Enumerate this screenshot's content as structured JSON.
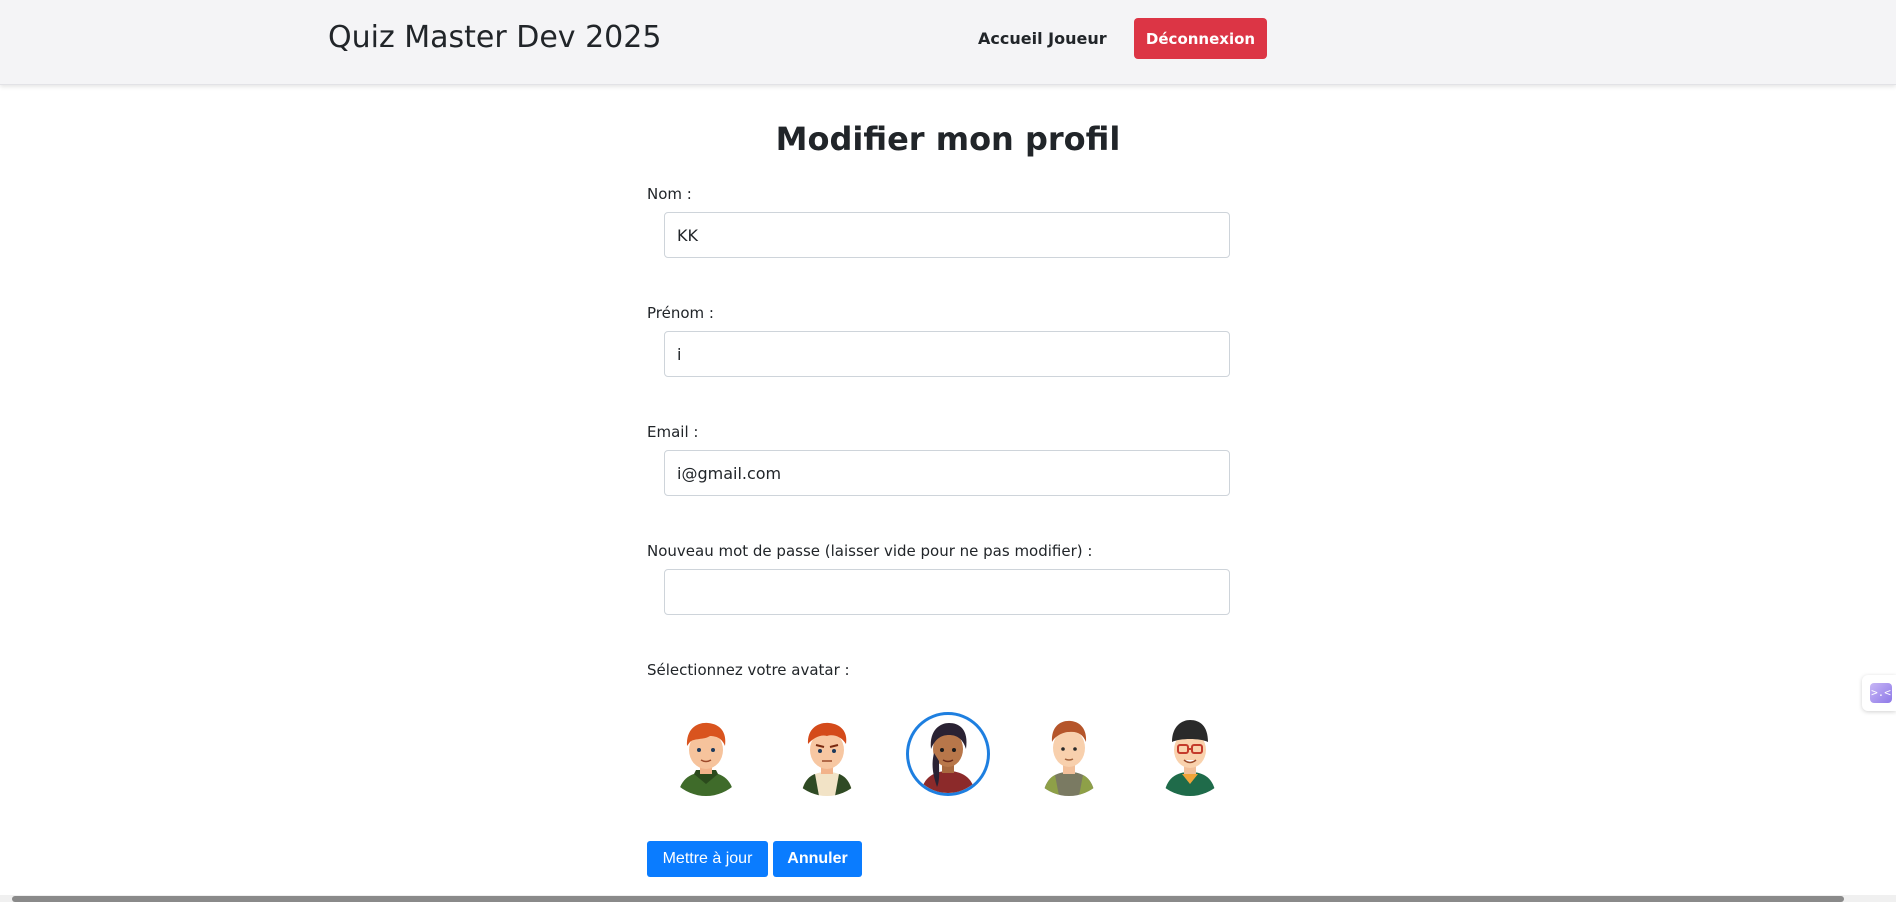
{
  "navbar": {
    "brand": "Quiz Master Dev 2025",
    "home_link": "Accueil Joueur",
    "logout_label": "Déconnexion"
  },
  "page": {
    "title": "Modifier mon profil"
  },
  "form": {
    "nom": {
      "label": "Nom :",
      "value": "KK"
    },
    "prenom": {
      "label": "Prénom :",
      "value": "i"
    },
    "email": {
      "label": "Email :",
      "value": "i@gmail.com"
    },
    "password": {
      "label": "Nouveau mot de passe (laisser vide pour ne pas modifier) :",
      "value": ""
    },
    "avatar_label": "Sélectionnez votre avatar :",
    "avatars": [
      {
        "icon": "avatar-redhead-boy-green-hoodie-icon",
        "selected": false
      },
      {
        "icon": "avatar-redhead-boy-angry-icon",
        "selected": false
      },
      {
        "icon": "avatar-girl-braid-icon",
        "selected": true
      },
      {
        "icon": "avatar-boy-brown-hair-gray-jacket-icon",
        "selected": false
      },
      {
        "icon": "avatar-boy-glasses-beanie-icon",
        "selected": false
      }
    ],
    "submit_label": "Mettre à jour",
    "cancel_label": "Annuler"
  },
  "colors": {
    "primary": "#0a7cff",
    "danger": "#dc3545",
    "selected_ring": "#1e7fe0",
    "navbar_bg": "#f4f4f6"
  },
  "side_widget": {
    "glyph": ">.<"
  }
}
